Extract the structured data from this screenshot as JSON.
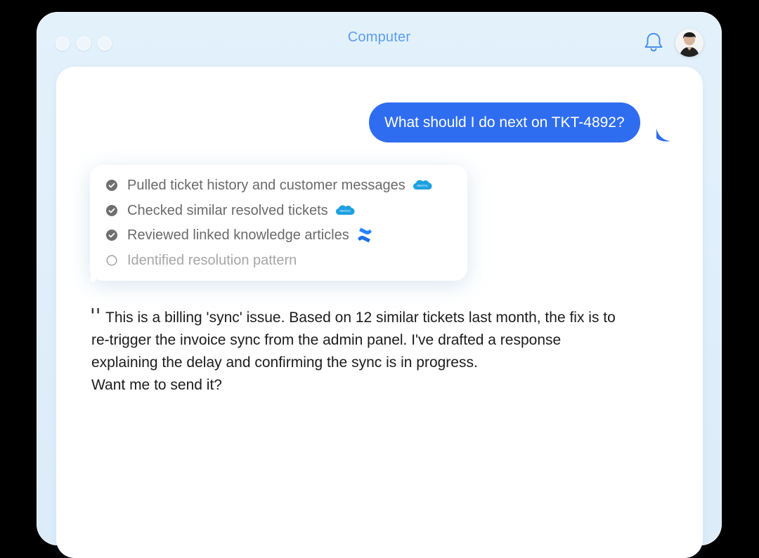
{
  "window": {
    "title": "Computer"
  },
  "header": {
    "bell_icon": "bell-icon",
    "avatar": "user-avatar"
  },
  "chat": {
    "user_message": "What should I do next on TKT-4892?",
    "steps": [
      {
        "label": "Pulled ticket history and customer messages",
        "status": "done",
        "source": "salesforce"
      },
      {
        "label": "Checked similar resolved tickets",
        "status": "done",
        "source": "salesforce"
      },
      {
        "label": "Reviewed linked knowledge articles",
        "status": "done",
        "source": "confluence"
      },
      {
        "label": "Identified resolution pattern",
        "status": "pending",
        "source": ""
      }
    ],
    "answer_lines": [
      "This is a billing 'sync' issue. Based on 12 similar tickets last month, the fix is to",
      "re-trigger the invoice sync from the admin panel. I've drafted a response",
      "explaining the delay and confirming the sync is in progress.",
      "Want me to send it?"
    ],
    "quote_mark": "''"
  },
  "colors": {
    "accent": "#2f6df0",
    "title": "#5b9cf0",
    "salesforce": "#1ea1e0",
    "confluence": "#1f6fe5"
  }
}
